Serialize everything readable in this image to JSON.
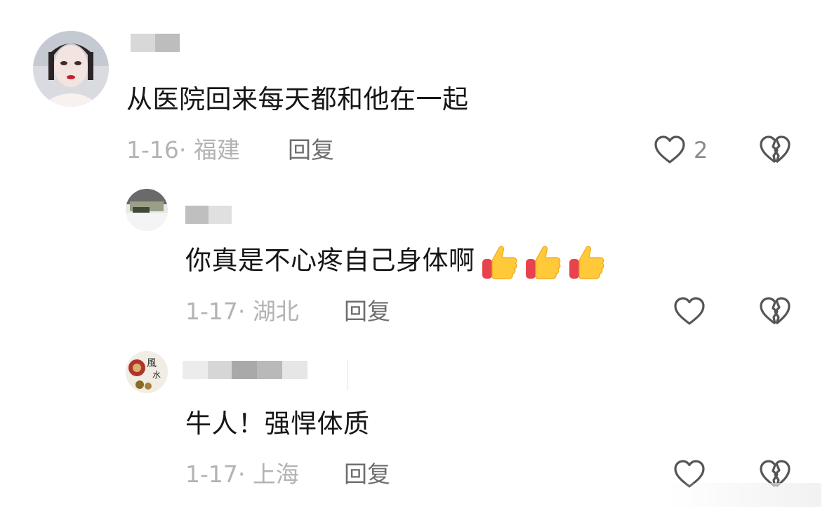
{
  "comments": [
    {
      "text": "从医院回来每天都和他在一起",
      "date": "1-16",
      "location": "福建",
      "reply_label": "回复",
      "like_count": "2"
    },
    {
      "text": "你真是不心疼自己身体啊",
      "date": "1-17",
      "location": "湖北",
      "reply_label": "回复",
      "emoji": [
        "thumbs-up",
        "thumbs-up",
        "thumbs-up"
      ]
    },
    {
      "text": "牛人！强悍体质",
      "date": "1-17",
      "location": "上海",
      "reply_label": "回复"
    }
  ],
  "colors": {
    "meta": "#b3b3b3",
    "reply": "#6e6e6e",
    "icon_stroke": "#555555",
    "thumb_yellow": "#ffc93a",
    "thumb_red": "#e8424f"
  },
  "icons": [
    "heart-outline-icon",
    "broken-heart-icon",
    "thumbs-up-emoji"
  ]
}
